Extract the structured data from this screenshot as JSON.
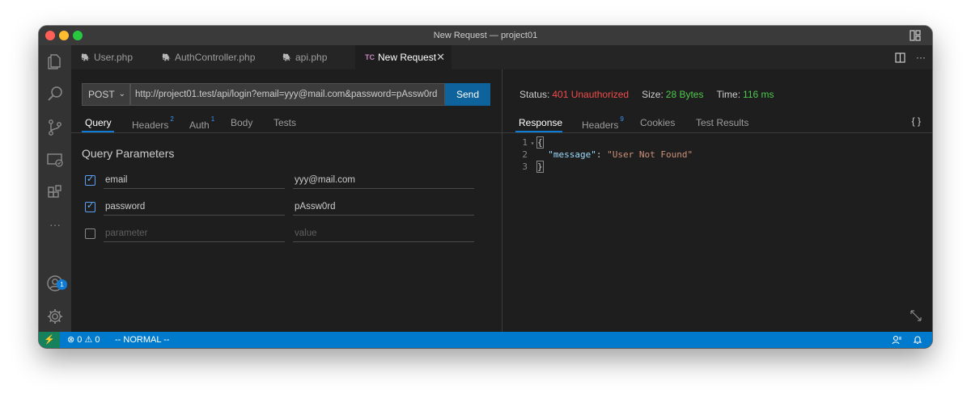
{
  "window": {
    "title": "New Request — project01"
  },
  "tabs": [
    {
      "label": "User.php",
      "glyph": "🐘",
      "active": false
    },
    {
      "label": "AuthController.php",
      "glyph": "🐘",
      "active": false
    },
    {
      "label": "api.php",
      "glyph": "🐘",
      "active": false
    },
    {
      "label": "New Request",
      "glyph": "TC",
      "active": true
    }
  ],
  "tab_actions": {
    "split_icon": "split-editor-icon",
    "more_label": "···"
  },
  "activity_bar": {
    "icons": [
      "explorer-icon",
      "search-icon",
      "source-control-icon",
      "remote-explorer-icon",
      "extensions-icon",
      "more-icon",
      "account-icon",
      "settings-gear-icon"
    ],
    "more_label": "···",
    "account_badge": "1"
  },
  "request": {
    "method": "POST",
    "url": "http://project01.test/api/login?email=yyy@mail.com&password=pAssw0rd",
    "send_label": "Send",
    "subtabs": [
      {
        "label": "Query",
        "count": ""
      },
      {
        "label": "Headers",
        "count": "2"
      },
      {
        "label": "Auth",
        "count": "1"
      },
      {
        "label": "Body",
        "count": ""
      },
      {
        "label": "Tests",
        "count": ""
      }
    ],
    "query_title": "Query Parameters",
    "params": [
      {
        "checked": true,
        "name": "email",
        "value": "yyy@mail.com"
      },
      {
        "checked": true,
        "name": "password",
        "value": "pAssw0rd"
      },
      {
        "checked": false,
        "name_placeholder": "parameter",
        "value_placeholder": "value"
      }
    ]
  },
  "response": {
    "status_label": "Status:",
    "status_value": "401 Unauthorized",
    "size_label": "Size:",
    "size_value": "28 Bytes",
    "time_label": "Time:",
    "time_value": "116 ms",
    "subtabs": [
      {
        "label": "Response",
        "count": ""
      },
      {
        "label": "Headers",
        "count": "9"
      },
      {
        "label": "Cookies",
        "count": ""
      },
      {
        "label": "Test Results",
        "count": ""
      }
    ],
    "format_label": "{ }",
    "body_lines": [
      {
        "num": "1",
        "open": "{"
      },
      {
        "num": "2",
        "key": "\"message\"",
        "sep": ": ",
        "value": "\"User Not Found\""
      },
      {
        "num": "3",
        "close": "}"
      }
    ]
  },
  "statusbar": {
    "errors": "0",
    "warnings": "0",
    "mode": "-- NORMAL --"
  },
  "colors": {
    "status_error": "#f14c4c",
    "status_ok": "#4ec94e",
    "accent": "#007acc",
    "send_button": "#0e639c"
  }
}
